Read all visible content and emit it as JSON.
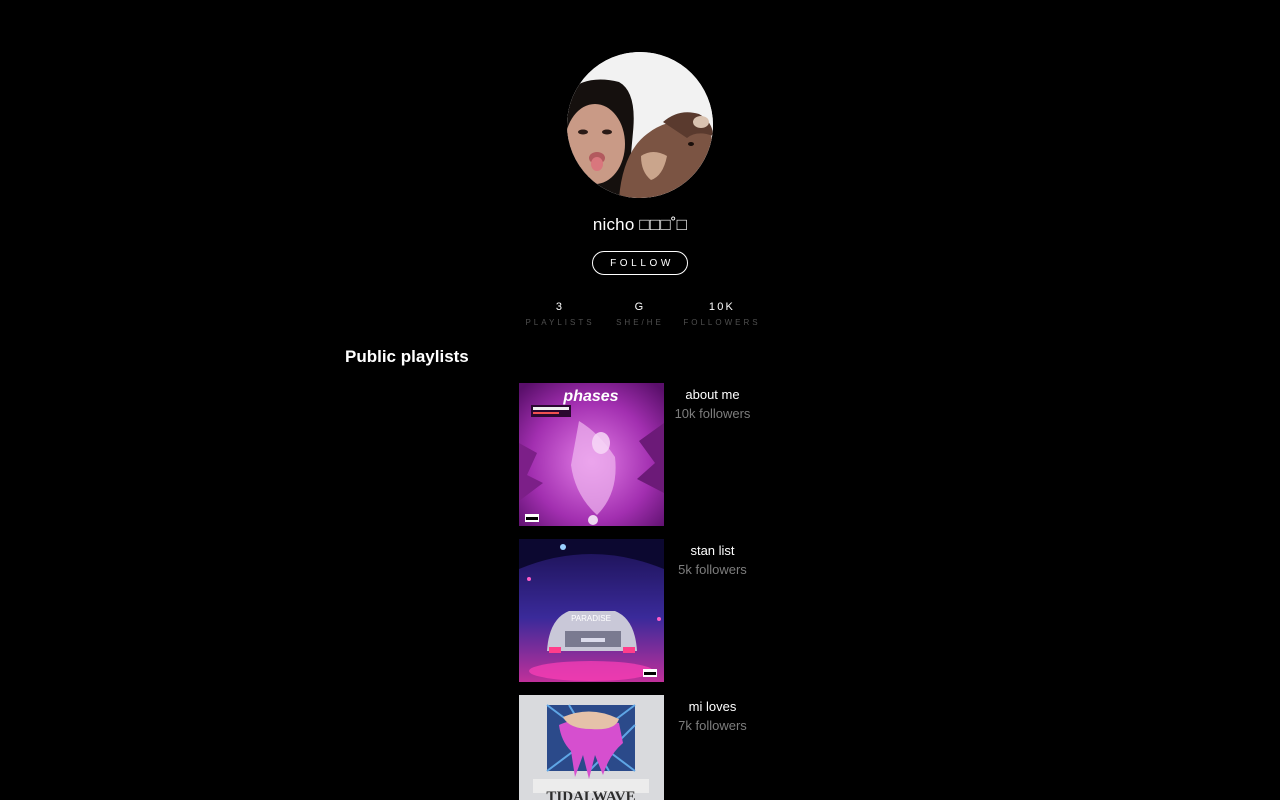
{
  "profile": {
    "display_name": "nicho □□□˚□",
    "follow_label": "FOLLOW",
    "avatar_description_icon": "avatar-photo"
  },
  "stats": [
    {
      "value": "3",
      "label": "PLAYLISTS"
    },
    {
      "value": "G",
      "label": "SHE/HE"
    },
    {
      "value": "10K",
      "label": "FOLLOWERS"
    }
  ],
  "section": {
    "title": "Public playlists"
  },
  "playlists": [
    {
      "title": "about me",
      "followers": "10k followers",
      "cover_text": "phases"
    },
    {
      "title": "stan list",
      "followers": "5k followers",
      "cover_text": "PARADISE"
    },
    {
      "title": "mi loves",
      "followers": "7k followers",
      "cover_text": "TIDALWAVE"
    }
  ],
  "colors": {
    "background": "#000000",
    "text": "#ffffff",
    "muted": "#7d7d7d",
    "label": "#4f4f4f"
  }
}
